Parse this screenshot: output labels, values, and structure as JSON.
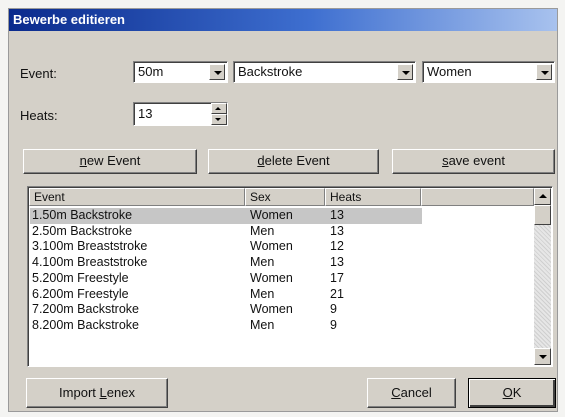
{
  "window": {
    "title": "Bewerbe editieren"
  },
  "form": {
    "event_label": "Event:",
    "distance": "50m",
    "stroke": "Backstroke",
    "sex": "Women",
    "heats_label": "Heats:",
    "heats_value": "13"
  },
  "buttons": {
    "new_event": {
      "pre": "",
      "key": "n",
      "post": "ew Event"
    },
    "delete_event": {
      "pre": "",
      "key": "d",
      "post": "elete Event"
    },
    "save_event": {
      "pre": "",
      "key": "s",
      "post": "ave event"
    },
    "import_lenex": {
      "pre": "Import ",
      "key": "L",
      "post": "enex"
    },
    "cancel": {
      "pre": "",
      "key": "C",
      "post": "ancel"
    },
    "ok": {
      "pre": "",
      "key": "O",
      "post": "K"
    }
  },
  "table": {
    "columns": [
      "Event",
      "Sex",
      "Heats",
      ""
    ],
    "rows": [
      {
        "event": "1.50m Backstroke",
        "sex": "Women",
        "heats": "13",
        "selected": true
      },
      {
        "event": "2.50m Backstroke",
        "sex": "Men",
        "heats": "13"
      },
      {
        "event": "3.100m Breaststroke",
        "sex": "Women",
        "heats": "12"
      },
      {
        "event": "4.100m Breaststroke",
        "sex": "Men",
        "heats": "13"
      },
      {
        "event": "5.200m Freestyle",
        "sex": "Women",
        "heats": "17"
      },
      {
        "event": "6.200m Freestyle",
        "sex": "Men",
        "heats": "21"
      },
      {
        "event": "7.200m Backstroke",
        "sex": "Women",
        "heats": "9"
      },
      {
        "event": "8.200m Backstroke",
        "sex": "Men",
        "heats": "9"
      }
    ]
  },
  "colors": {
    "title_start": "#0a2a8c",
    "title_end": "#a8c2ee",
    "face": "#d4d0c8",
    "selection": "#c6c6c6"
  }
}
